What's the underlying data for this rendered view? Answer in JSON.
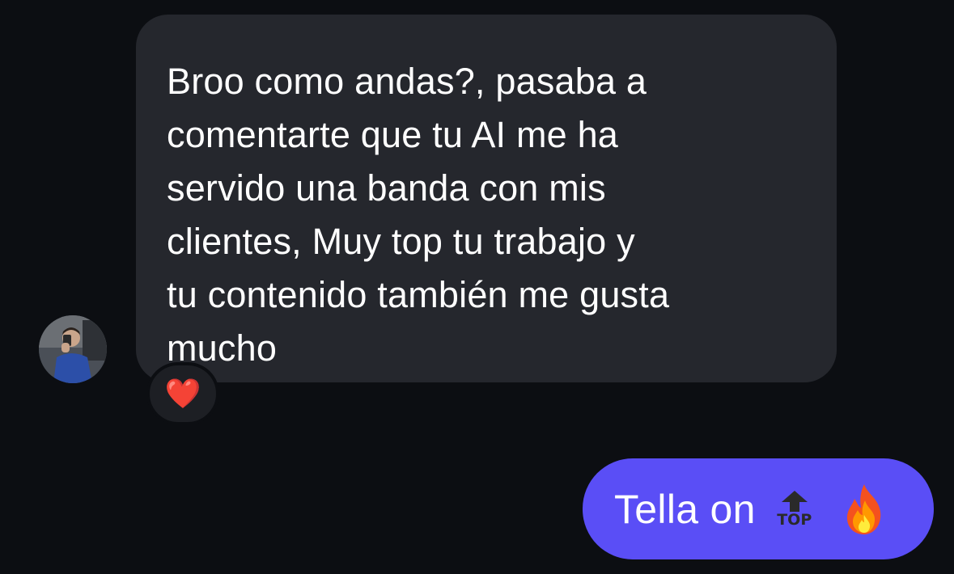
{
  "conversation": {
    "incoming": {
      "text": "Broo como andas?, pasaba a comentarte que tu AI me ha servido una banda con mis clientes, Muy top tu trabajo y tu contenido también me gusta mucho",
      "lines": [
        "Broo como andas?, pasaba a",
        "comentarte que tu AI me ha",
        "servido una banda con mis",
        "clientes, Muy top tu trabajo y",
        "tu contenido también me gusta",
        "mucho"
      ],
      "reaction": "❤️",
      "avatar_icon": "user-avatar-photo"
    },
    "outgoing": {
      "text": "Tella on",
      "emoji_top_label": "TOP",
      "emoji_top_icon": "top-arrow-icon",
      "emoji_fire_icon": "fire-icon"
    }
  },
  "colors": {
    "background": "#0c0e12",
    "incoming_bubble": "#25272d",
    "outgoing_bubble": "#5a4ef6",
    "text": "#ffffff"
  }
}
